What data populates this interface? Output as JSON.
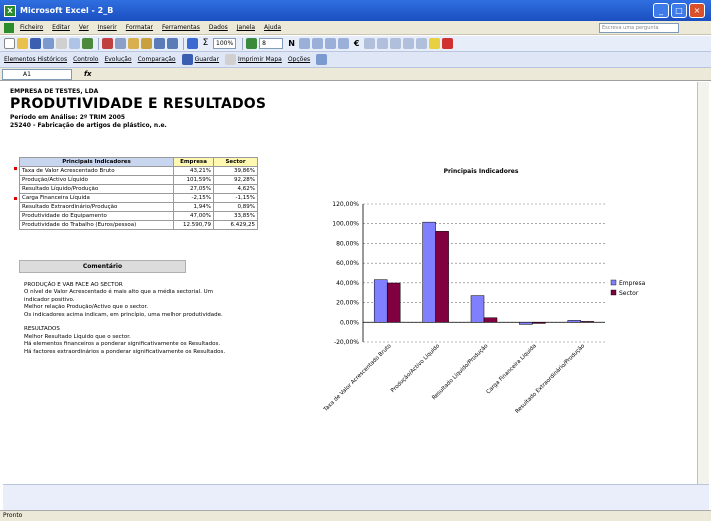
{
  "window": {
    "title": "Microsoft Excel - 2_B",
    "min": "_",
    "max": "□",
    "close": "×"
  },
  "menu": [
    "Ficheiro",
    "Editar",
    "Ver",
    "Inserir",
    "Formatar",
    "Ferramentas",
    "Dados",
    "Janela",
    "Ajuda"
  ],
  "help_placeholder": "Escreva uma pergunta",
  "toolbar1": {
    "zoom": "100%",
    "font_size": "8",
    "bold": "N",
    "currency": "€"
  },
  "toolbar2": {
    "items": [
      "Elementos Históricos",
      "Controlo",
      "Evolução",
      "Comparação",
      "Guardar",
      "Imprimir Mapa",
      "Opções"
    ]
  },
  "formula": {
    "cell": "A1",
    "fx": "fx"
  },
  "report": {
    "company": "EMPRESA DE TESTES, LDA",
    "title": "PRODUTIVIDADE E RESULTADOS",
    "period": "Período em Análise: 2º TRIM 2005",
    "activity": "25240 - Fabricação de artigos de plástico, n.e."
  },
  "table": {
    "headers": [
      "Principais Indicadores",
      "Empresa",
      "Sector"
    ],
    "rows": [
      [
        "Taxa de Valor Acrescentado Bruto",
        "43,21%",
        "39,86%"
      ],
      [
        "Produção/Activo Líquido",
        "101,59%",
        "92,28%"
      ],
      [
        "Resultado Líquido/Produção",
        "27,05%",
        "4,62%"
      ],
      [
        "Carga Financeira Líquida",
        "-2,15%",
        "-1,15%"
      ],
      [
        "Resultado Extraordinário/Produção",
        "1,94%",
        "0,89%"
      ],
      [
        "Produtividade do Equipamento",
        "47,00%",
        "33,85%"
      ],
      [
        "Produtividade do Trabalho (Euros/pessoa)",
        "12.590,79",
        "6.429,25"
      ]
    ]
  },
  "comment_button": "Comentário",
  "comment_lines": [
    "PRODUÇÃO E VAB FACE AO SECTOR",
    "O nível de Valor Acrescentado é mais alto que a média sectorial. Um",
    "indicador positivo.",
    "Melhor relação Produção/Activo que o sector.",
    "Os indicadores acima indicam, em princípio, uma melhor produtividade.",
    "",
    "RESULTADOS",
    "Melhor Resultado Líquido que o sector.",
    "Há elementos financeiros a ponderar significativamente os Resultados.",
    "Há factores extraordinários a ponderar significativamente os Resultados."
  ],
  "status": "Pronto",
  "colors": {
    "empresa": "#8080ff",
    "sector": "#800040",
    "title_bar": "#2f6fe0"
  },
  "chart_data": {
    "type": "bar",
    "title": "Principais Indicadores",
    "categories": [
      "Taxa de Valor Acrescentado Bruto",
      "Produção/Activo Líquido",
      "Resultado Líquido/Produção",
      "Carga Financeira Líquida",
      "Resultado Extraordinário/Produção"
    ],
    "series": [
      {
        "name": "Empresa",
        "values": [
          43.21,
          101.59,
          27.05,
          -2.15,
          1.94
        ]
      },
      {
        "name": "Sector",
        "values": [
          39.86,
          92.28,
          4.62,
          -1.15,
          0.89
        ]
      }
    ],
    "yticks": [
      "120,00%",
      "100,00%",
      "80,00%",
      "60,00%",
      "40,00%",
      "20,00%",
      "0,00%",
      "-20,00%"
    ],
    "ylim": [
      -20,
      120
    ],
    "grid": true,
    "legend": "right"
  }
}
